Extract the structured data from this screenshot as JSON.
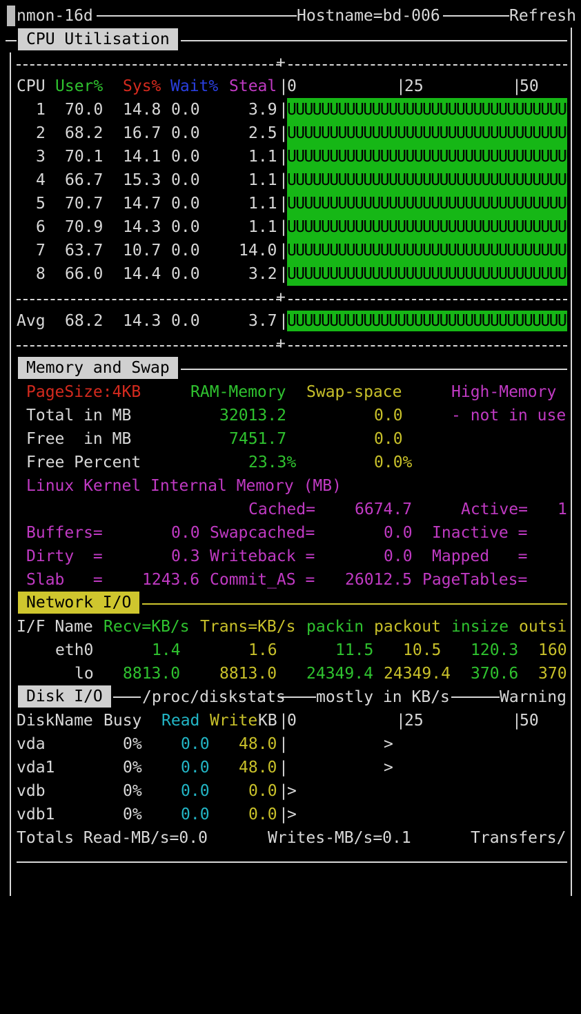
{
  "header": {
    "app": "nmon-16d",
    "hostname": "Hostname=bd-006",
    "refresh": "Refresh"
  },
  "cpu": {
    "section_title": "CPU Utilisation",
    "headers": {
      "cpu": "CPU",
      "user": "User%",
      "sys": "Sys%",
      "wait": "Wait%",
      "steal": "Steal"
    },
    "scale": [
      "0",
      "25",
      "50"
    ],
    "rows": [
      {
        "id": "1",
        "user": "70.0",
        "sys": "14.8",
        "wait": "0.0",
        "steal": "3.9"
      },
      {
        "id": "2",
        "user": "68.2",
        "sys": "16.7",
        "wait": "0.0",
        "steal": "2.5"
      },
      {
        "id": "3",
        "user": "70.1",
        "sys": "14.1",
        "wait": "0.0",
        "steal": "1.1"
      },
      {
        "id": "4",
        "user": "66.7",
        "sys": "15.3",
        "wait": "0.0",
        "steal": "1.1"
      },
      {
        "id": "5",
        "user": "70.7",
        "sys": "14.7",
        "wait": "0.0",
        "steal": "1.1"
      },
      {
        "id": "6",
        "user": "70.9",
        "sys": "14.3",
        "wait": "0.0",
        "steal": "1.1"
      },
      {
        "id": "7",
        "user": "63.7",
        "sys": "10.7",
        "wait": "0.0",
        "steal": "14.0"
      },
      {
        "id": "8",
        "user": "66.0",
        "sys": "14.4",
        "wait": "0.0",
        "steal": "3.2"
      }
    ],
    "avg": {
      "id": "Avg",
      "user": "68.2",
      "sys": "14.3",
      "wait": "0.0",
      "steal": "3.7"
    },
    "bar_text": "UUUUUUUUUUUUUUUUUUUUUUUUUUUUUUUUUUUUU"
  },
  "memory": {
    "section_title": "Memory and Swap",
    "pagesize": "PageSize:4KB",
    "ram_header": "RAM-Memory",
    "swap_header": "Swap-space",
    "high_header": "High-Memory",
    "total_label": "Total in MB",
    "total_ram": "32013.2",
    "total_swap": "0.0",
    "high_note": "- not in use",
    "free_label": "Free  in MB",
    "free_ram": "7451.7",
    "free_swap": "0.0",
    "freepct_label": "Free Percent",
    "freepct_ram": "23.3%",
    "freepct_swap": "0.0%",
    "kernel_title": "Linux Kernel Internal Memory (MB)",
    "cached_label": "Cached=",
    "cached_val": "6674.7",
    "active_label": "Active=",
    "active_val": "1",
    "buffers_label": "Buffers=",
    "buffers_val": "0.0",
    "swapcached_label": "Swapcached=",
    "swapcached_val": "0.0",
    "inactive_label": "Inactive =",
    "dirty_label": "Dirty  =",
    "dirty_val": "0.3",
    "writeback_label": "Writeback =",
    "writeback_val": "0.0",
    "mapped_label": "Mapped   =",
    "slab_label": "Slab   =",
    "slab_val": "1243.6",
    "commit_label": "Commit_AS =",
    "commit_val": "26012.5",
    "pagetables_label": "PageTables="
  },
  "network": {
    "section_title": "Network I/O",
    "headers": {
      "ifname": "I/F Name",
      "recv": "Recv=KB/s",
      "trans": "Trans=KB/s",
      "packin": "packin",
      "packout": "packout",
      "insize": "insize",
      "outsize": "outsi"
    },
    "rows": [
      {
        "name": "eth0",
        "recv": "1.4",
        "trans": "1.6",
        "packin": "11.5",
        "packout": "10.5",
        "insize": "120.3",
        "outsize": "160"
      },
      {
        "name": "lo",
        "recv": "8813.0",
        "trans": "8813.0",
        "packin": "24349.4",
        "packout": "24349.4",
        "insize": "370.6",
        "outsize": "370"
      }
    ]
  },
  "disk": {
    "section_title": "Disk I/O",
    "path": "/proc/diskstats",
    "units": "mostly in KB/s",
    "warning": "Warning",
    "headers": {
      "name": "DiskName",
      "busy": "Busy",
      "read": "Read",
      "write": "Write",
      "kb": "KB"
    },
    "scale": [
      "0",
      "25",
      "50"
    ],
    "rows": [
      {
        "name": "vda",
        "busy": "0%",
        "read": "0.0",
        "write": "48.0",
        "marker": ">"
      },
      {
        "name": "vda1",
        "busy": "0%",
        "read": "0.0",
        "write": "48.0",
        "marker": ">"
      },
      {
        "name": "vdb",
        "busy": "0%",
        "read": "0.0",
        "write": "0.0",
        "marker": ">"
      },
      {
        "name": "vdb1",
        "busy": "0%",
        "read": "0.0",
        "write": "0.0",
        "marker": ">"
      }
    ],
    "totals": {
      "read": "Totals Read-MB/s=0.0",
      "write": "Writes-MB/s=0.1",
      "transfers": "Transfers/"
    }
  },
  "colors": {
    "user": "#2fc22f",
    "sys": "#d42a1e",
    "wait": "#2a3fe0",
    "steal": "#c03ac3",
    "bar": "#16b716",
    "cyan": "#22b5c5",
    "yellow": "#c8c02a"
  }
}
